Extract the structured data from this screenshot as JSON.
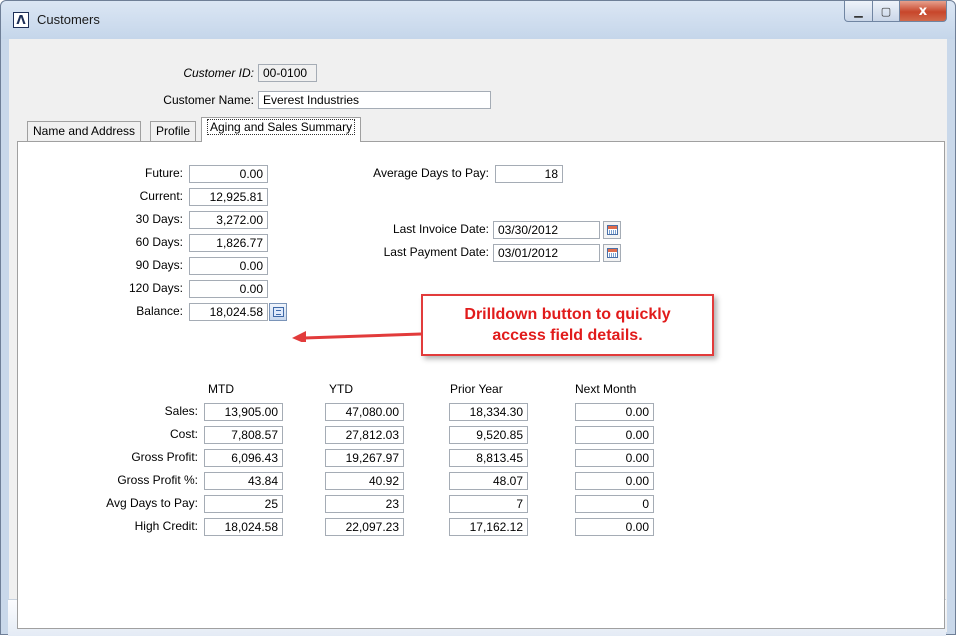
{
  "window": {
    "title": "Customers",
    "app_icon_glyph": "Λ",
    "minimize_glyph": "▁",
    "maximize_glyph": "▢",
    "close_glyph": "x"
  },
  "header": {
    "customer_id_label": "Customer ID:",
    "customer_id": "00-0100",
    "customer_name_label": "Customer Name:",
    "customer_name": "Everest Industries"
  },
  "tabs": [
    {
      "label": "Name and Address",
      "active": false
    },
    {
      "label": "Profile",
      "active": false
    },
    {
      "label": "Aging and Sales Summary",
      "active": true
    }
  ],
  "aging": {
    "future_label": "Future:",
    "future": "0.00",
    "current_label": "Current:",
    "current": "12,925.81",
    "d30_label": "30 Days:",
    "d30": "3,272.00",
    "d60_label": "60 Days:",
    "d60": "1,826.77",
    "d90_label": "90 Days:",
    "d90": "0.00",
    "d120_label": "120 Days:",
    "d120": "0.00",
    "balance_label": "Balance:",
    "balance": "18,024.58"
  },
  "payment_info": {
    "avg_days_label": "Average Days to Pay:",
    "avg_days": "18",
    "last_invoice_label": "Last Invoice Date:",
    "last_invoice": "03/30/2012",
    "last_payment_label": "Last Payment Date:",
    "last_payment": "03/01/2012"
  },
  "callout": {
    "line1": "Drilldown button to quickly",
    "line2": "access field details.",
    "color": "#e11b1b"
  },
  "summary": {
    "columns": [
      "MTD",
      "YTD",
      "Prior Year",
      "Next Month"
    ],
    "rows": [
      {
        "label": "Sales:",
        "values": [
          "13,905.00",
          "47,080.00",
          "18,334.30",
          "0.00"
        ]
      },
      {
        "label": "Cost:",
        "values": [
          "7,808.57",
          "27,812.03",
          "9,520.85",
          "0.00"
        ]
      },
      {
        "label": "Gross Profit:",
        "values": [
          "6,096.43",
          "19,267.97",
          "8,813.45",
          "0.00"
        ]
      },
      {
        "label": "Gross Profit %:",
        "values": [
          "43.84",
          "40.92",
          "48.07",
          "0.00"
        ]
      },
      {
        "label": "Avg Days to Pay:",
        "values": [
          "25",
          "23",
          "7",
          "0"
        ]
      },
      {
        "label": "High Credit:",
        "values": [
          "18,024.58",
          "22,097.23",
          "17,162.12",
          "0.00"
        ]
      }
    ]
  },
  "toolbar": {
    "icons": [
      "new-record-icon",
      "delete-icon",
      "save-icon",
      "first-record-icon",
      "previous-record-icon",
      "next-record-icon",
      "last-record-icon",
      "find-icon",
      "find-dropdown-icon",
      "disabled-action-icon",
      "list-view-icon"
    ]
  }
}
